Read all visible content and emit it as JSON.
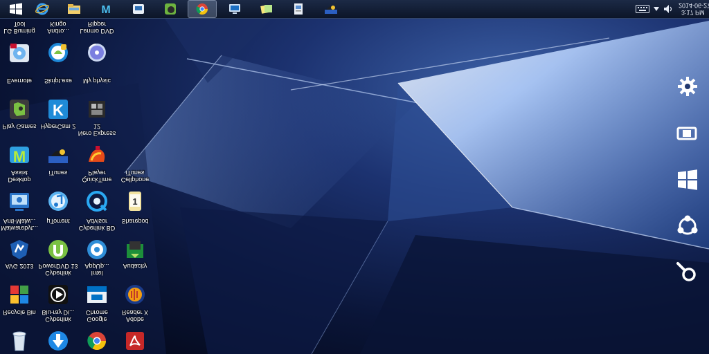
{
  "taskbar": {
    "buttons": [
      {
        "name": "start-button",
        "icon": "windows-logo-icon"
      },
      {
        "name": "internet-explorer-button",
        "icon": "ie-icon"
      },
      {
        "name": "file-explorer-button",
        "icon": "folder-icon"
      },
      {
        "name": "maxthon-button",
        "icon": "maxthon-icon"
      },
      {
        "name": "tablet-app-button",
        "icon": "tablet-icon"
      },
      {
        "name": "evernote-button",
        "icon": "evernote-icon"
      },
      {
        "name": "chrome-button",
        "icon": "chrome-icon",
        "active": true
      },
      {
        "name": "monitor-app-button",
        "icon": "monitor-icon"
      },
      {
        "name": "sticky-notes-button",
        "icon": "notes-icon"
      },
      {
        "name": "document-button",
        "icon": "document-icon"
      },
      {
        "name": "hypercam-button",
        "icon": "hypercam-icon"
      }
    ]
  },
  "tray": {
    "time": "3:17 PM",
    "date": "2014-06-27",
    "icons": [
      "keyboard-icon",
      "chevron-icon",
      "volume-icon"
    ]
  },
  "desktop_icons": [
    {
      "label": "LG Burning\nTool",
      "icon": "lg-burning-icon"
    },
    {
      "label": "Andro...\nKingo",
      "icon": "kingo-icon"
    },
    {
      "label": "Lenmo DVD\nRipper",
      "icon": "dvd-ripper-icon"
    },
    {
      "label": "Evernote",
      "icon": "evernote-icon"
    },
    {
      "label": "Skript.exe",
      "icon": "k-app-icon"
    },
    {
      "label": "My physic",
      "icon": "physic-icon"
    },
    {
      "label": "Play Games",
      "icon": "maxthon-icon"
    },
    {
      "label": "HyperCam 2",
      "icon": "hypercam-icon"
    },
    {
      "label": "Nero Express\n12",
      "icon": "nero-icon"
    },
    {
      "label": "Desktop\nAssist",
      "icon": "desktop-assist-icon"
    },
    {
      "label": "iTunes",
      "icon": "itunes-icon"
    },
    {
      "label": "QuickTime\nPlayer",
      "icon": "quicktime-icon"
    },
    {
      "label": "Cellphone\niTunes",
      "icon": "cellphone-icon"
    },
    {
      "label": "Malwarebyt...\nAnti-Malw...",
      "icon": "malwarebytes-icon"
    },
    {
      "label": "µTorrent",
      "icon": "utorrent-icon"
    },
    {
      "label": "Cyberlink BD\nAdvisor",
      "icon": "bd-advisor-icon"
    },
    {
      "label": "Sharepod",
      "icon": "sharepod-icon"
    },
    {
      "label": "AVG 2013",
      "icon": "avg-icon"
    },
    {
      "label": "Cyberlink\nPowerDVD 13",
      "icon": "powerdvd-icon"
    },
    {
      "label": "Intel\nAppUp...",
      "icon": "intel-icon"
    },
    {
      "label": "Audacity",
      "icon": "audacity-icon"
    },
    {
      "label": "Recycle Bin",
      "icon": "recycle-bin-icon"
    },
    {
      "label": "Cyberlink\nBlu-ray Di...",
      "icon": "bluray-icon"
    },
    {
      "label": "Google\nChrome",
      "icon": "chrome-icon"
    },
    {
      "label": "Adobe\nReader X",
      "icon": "adobe-reader-icon"
    }
  ],
  "charms": [
    "settings-icon",
    "devices-icon",
    "start-icon",
    "share-icon",
    "search-icon"
  ]
}
